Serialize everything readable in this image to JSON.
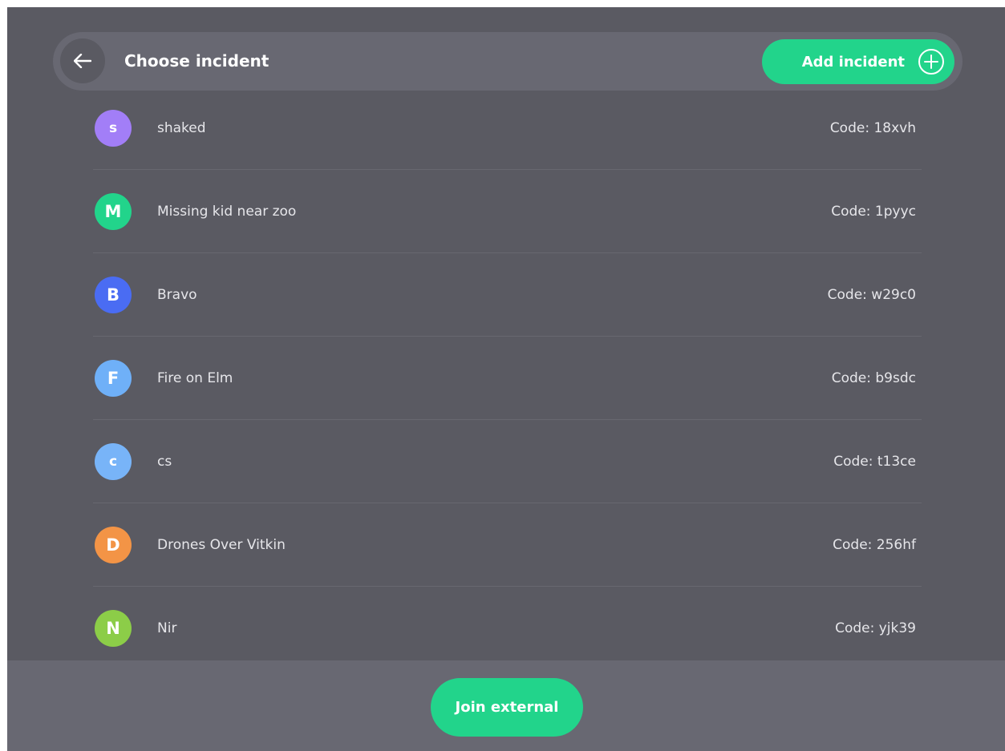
{
  "header": {
    "title": "Choose incident",
    "back_icon": "arrow-left-icon",
    "add_label": "Add incident",
    "add_icon": "plus-circle-icon"
  },
  "incidents": [
    {
      "initial": "s",
      "name": "shaked",
      "code": "Code: 18xvh",
      "color": "#a27ef7"
    },
    {
      "initial": "M",
      "name": "Missing kid near zoo",
      "code": "Code: 1pyyc",
      "color": "#22d48b"
    },
    {
      "initial": "B",
      "name": "Bravo",
      "code": "Code: w29c0",
      "color": "#4a6cf3"
    },
    {
      "initial": "F",
      "name": "Fire on Elm",
      "code": "Code: b9sdc",
      "color": "#6fb0f8"
    },
    {
      "initial": "c",
      "name": "cs",
      "code": "Code: t13ce",
      "color": "#78b4f8"
    },
    {
      "initial": "D",
      "name": "Drones Over Vitkin",
      "code": "Code: 256hf",
      "color": "#f39446"
    },
    {
      "initial": "N",
      "name": "Nir",
      "code": "Code: yjk39",
      "color": "#8ccd48"
    }
  ],
  "footer": {
    "join_label": "Join external"
  },
  "colors": {
    "background": "#5a5a62",
    "header_bar": "#686872",
    "accent_green": "#22d48b",
    "divider": "#686870"
  }
}
